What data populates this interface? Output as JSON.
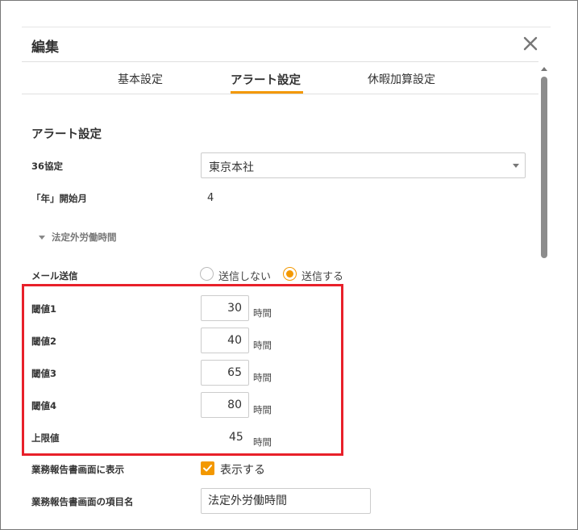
{
  "dialog": {
    "title": "編集"
  },
  "tabs": [
    {
      "label": "基本設定",
      "active": false
    },
    {
      "label": "アラート設定",
      "active": true
    },
    {
      "label": "休暇加算設定",
      "active": false
    }
  ],
  "section": {
    "title": "アラート設定"
  },
  "agreement36": {
    "label": "36協定",
    "value": "東京本社"
  },
  "year_start": {
    "label": "「年」開始月",
    "value": "4"
  },
  "collapse": {
    "label": "法定外労働時間"
  },
  "mail": {
    "label": "メール送信",
    "options": [
      {
        "label": "送信しない",
        "checked": false
      },
      {
        "label": "送信する",
        "checked": true
      }
    ]
  },
  "thresholds": [
    {
      "label": "閾値1",
      "value": "30",
      "unit": "時間"
    },
    {
      "label": "閾値2",
      "value": "40",
      "unit": "時間"
    },
    {
      "label": "閾値3",
      "value": "65",
      "unit": "時間"
    },
    {
      "label": "閾値4",
      "value": "80",
      "unit": "時間"
    }
  ],
  "limit": {
    "label": "上限値",
    "value": "45",
    "unit": "時間"
  },
  "report_display": {
    "label": "業務報告書画面に表示",
    "checkbox_label": "表示する",
    "checked": true
  },
  "report_item_name": {
    "label": "業務報告書画面の項目名",
    "value": "法定外労働時間"
  },
  "colors": {
    "accent": "#f39800",
    "highlight": "#e8202a"
  },
  "icons": {
    "close": "close-icon",
    "dropdown": "chevron-down-icon",
    "collapse": "caret-down-icon",
    "check": "check-icon"
  }
}
